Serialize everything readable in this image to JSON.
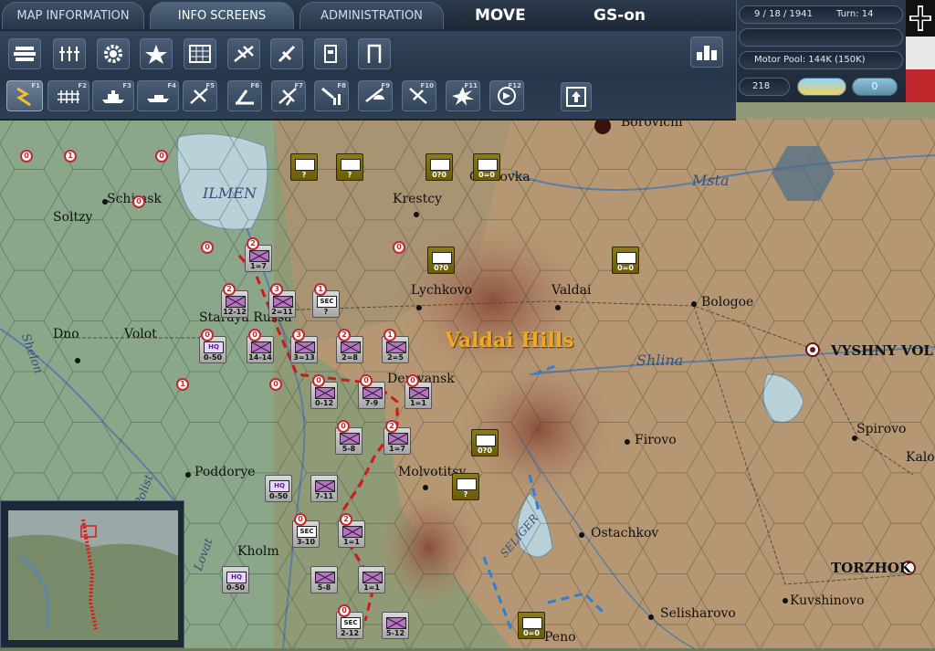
{
  "tabs": [
    {
      "label": "MAP INFORMATION"
    },
    {
      "label": "INFO SCREENS"
    },
    {
      "label": "ADMINISTRATION"
    }
  ],
  "mode": {
    "label": "MOVE",
    "gs": "GS-on"
  },
  "status": {
    "date": "9 / 18 / 1941",
    "turn": "Turn: 14",
    "motor_pool": "Motor Pool:  144K (150K)",
    "value": "218",
    "counter": "0"
  },
  "function_keys": [
    "F1",
    "F2",
    "F3",
    "F4",
    "F5",
    "F6",
    "F7",
    "F8",
    "F9",
    "F10",
    "F11",
    "F12"
  ],
  "map_labels": {
    "ilmen": "ILMEN",
    "msta": "Msta",
    "shlina": "Shlina",
    "shelon": "Shelon",
    "lovat": "Lovat",
    "polist": "Polist",
    "seliger": "SELIGER",
    "valdai_hills": "Valdai Hills",
    "soltzy": "Soltzy",
    "schimsk": "Schimsk",
    "dno": "Dno",
    "volot": "Volot",
    "staraya_russa": "Staraya Russa",
    "demyansk": "Demyansk",
    "poddorye": "Poddorye",
    "kholm": "Kholm",
    "molvotitsy": "Molvotitsy",
    "krestcy": "Krestcy",
    "lychkovo": "Lychkovo",
    "valdai": "Valdai",
    "bologoe": "Bologoe",
    "borovichi": "Borovichi",
    "okulovka": "Okulovka",
    "vyshny_volochek": "VYSHNY VOL",
    "firovo": "Firovo",
    "spirovo": "Spirovo",
    "kalinin": "Kalo",
    "ostachkov": "Ostachkov",
    "torzhok": "TORZHOK",
    "kuvshinovo": "Kuvshinovo",
    "selisharovo": "Selisharovo",
    "peno": "Peno"
  },
  "units": [
    {
      "id": "u1",
      "type": "ger inf",
      "str": "1=7",
      "badge": "2"
    },
    {
      "id": "u2",
      "type": "ger inf",
      "str": "12-12",
      "badge": "2"
    },
    {
      "id": "u3",
      "type": "ger inf",
      "str": "2=11",
      "badge": "3"
    },
    {
      "id": "u4",
      "type": "ger sec",
      "sym": "SEC",
      "str": "?",
      "badge": "1"
    },
    {
      "id": "u5",
      "type": "ger hq",
      "sym": "HQ",
      "str": "0-50",
      "badge": "0"
    },
    {
      "id": "u6",
      "type": "ger inf",
      "str": "14-14",
      "badge": "0"
    },
    {
      "id": "u7",
      "type": "ger inf",
      "str": "3=13",
      "badge": "3"
    },
    {
      "id": "u8",
      "type": "ger inf",
      "str": "2=8",
      "badge": "2"
    },
    {
      "id": "u9",
      "type": "ger inf",
      "str": "2=5",
      "badge": "1"
    },
    {
      "id": "u10",
      "type": "ger inf",
      "str": "0-12",
      "badge": "0"
    },
    {
      "id": "u11",
      "type": "ger inf",
      "str": "7-9",
      "badge": "0"
    },
    {
      "id": "u12",
      "type": "ger inf",
      "str": "1=1",
      "badge": "0"
    },
    {
      "id": "u13",
      "type": "ger inf",
      "str": "5-8",
      "badge": "0"
    },
    {
      "id": "u14",
      "type": "ger inf",
      "str": "1=7",
      "badge": "2"
    },
    {
      "id": "u15",
      "type": "ger hq",
      "sym": "HQ",
      "str": "0-50",
      "badge": ""
    },
    {
      "id": "u16",
      "type": "ger inf",
      "str": "7-11",
      "badge": ""
    },
    {
      "id": "u17",
      "type": "ger sec",
      "sym": "SEC",
      "str": "3-10",
      "badge": "0"
    },
    {
      "id": "u18",
      "type": "ger inf",
      "str": "1=1",
      "badge": "2"
    },
    {
      "id": "u19",
      "type": "ger hq",
      "sym": "HQ",
      "str": "0-50",
      "badge": ""
    },
    {
      "id": "u20",
      "type": "ger inf",
      "str": "5-8",
      "badge": ""
    },
    {
      "id": "u21",
      "type": "ger inf",
      "str": "1=1",
      "badge": ""
    },
    {
      "id": "u22",
      "type": "ger sec",
      "sym": "SEC",
      "str": "2-12",
      "badge": "0"
    },
    {
      "id": "u23",
      "type": "ger inf",
      "str": "5-12",
      "badge": ""
    },
    {
      "id": "s1",
      "type": "sov",
      "str": "?",
      "badge": ""
    },
    {
      "id": "s2",
      "type": "sov",
      "str": "?",
      "badge": ""
    },
    {
      "id": "s3",
      "type": "sov",
      "str": "0?0",
      "badge": ""
    },
    {
      "id": "s4",
      "type": "sov",
      "str": "0=0",
      "badge": ""
    },
    {
      "id": "s5",
      "type": "sov",
      "str": "0?0",
      "badge": ""
    },
    {
      "id": "s6",
      "type": "sov",
      "str": "0=0",
      "badge": ""
    },
    {
      "id": "s7",
      "type": "sov",
      "str": "0?0",
      "badge": ""
    },
    {
      "id": "s8",
      "type": "sov",
      "str": "?",
      "badge": ""
    },
    {
      "id": "s9",
      "type": "sov",
      "str": "0=0",
      "badge": ""
    }
  ],
  "badges_free": [
    "0",
    "1",
    "0",
    "0",
    "1",
    "0",
    "0",
    "0"
  ]
}
